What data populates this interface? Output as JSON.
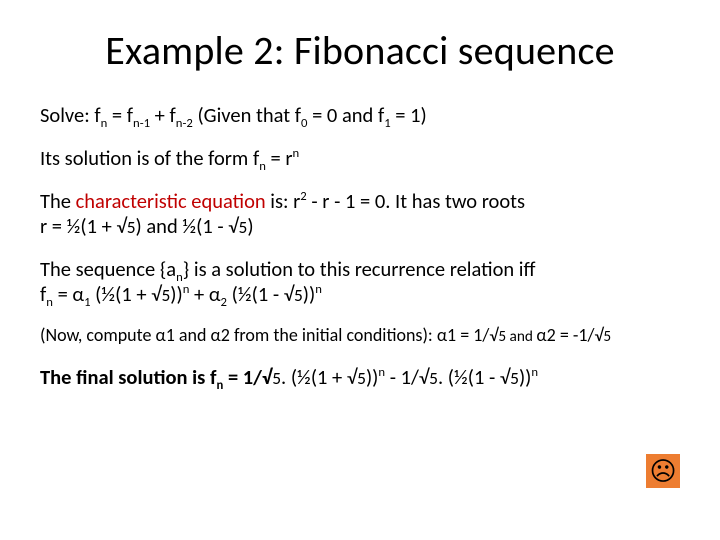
{
  "title": "Example 2: Fibonacci sequence",
  "line1": {
    "solve": "Solve:",
    "gap1": "  ",
    "fn": "f",
    "n": "n",
    "eq": " = f",
    "nm1": "n-1",
    "plus": " + f",
    "nm2": "n-2",
    "gap2": "     ",
    "given1": "(Given that f",
    "z": "0",
    "given2": " = 0 and f",
    "one": "1",
    "given3": " = 1)"
  },
  "line2": {
    "a": "Its solution is of the form  f",
    "n": "n",
    "b": " = r",
    "nsup": "n"
  },
  "line3": {
    "a": "The ",
    "char": "characteristic equation",
    "b": " is:       r",
    "sq": "2",
    "c": " - r - 1 = 0. It has two roots",
    "d": "r = ½(1 + √",
    "five1": "5",
    "e": ") and ½(1 - √",
    "five2": "5",
    "f": ")"
  },
  "line4": {
    "a": "The sequence {a",
    "n1": "n",
    "b": "} is a solution to this recurrence relation iff",
    "c": "f",
    "n2": "n",
    "d": " = α",
    "s1": "1",
    "e": " (½(1 + √",
    "five1": "5",
    "f": "))",
    "nsup1": "n",
    "g": " + α",
    "s2": "2",
    "h": " (½(1 - √",
    "five2": "5",
    "i": "))",
    "nsup2": "n"
  },
  "line5": {
    "a": "(Now, compute ",
    "al": "α",
    "one": "1 and ",
    "al2": "α",
    "two": "2 from the initial conditions): ",
    "al3": "α",
    "v1": "1 = 1/√",
    "five1": "5",
    "and": " and  ",
    "al4": "α",
    "v2": "2 = -1/√",
    "five2": "5"
  },
  "line6": {
    "a": "The final solution is f",
    "n": "n",
    "b": " = 1/√",
    "five1": "5",
    "c": ". (½(1 + √",
    "five2": "5",
    "d": "))",
    "nsup1": "n",
    "e": " - 1/√",
    "five3": "5",
    "f": ". (½(1 - √",
    "five4": "5",
    "g": "))",
    "nsup2": "n"
  },
  "sad": "☹"
}
